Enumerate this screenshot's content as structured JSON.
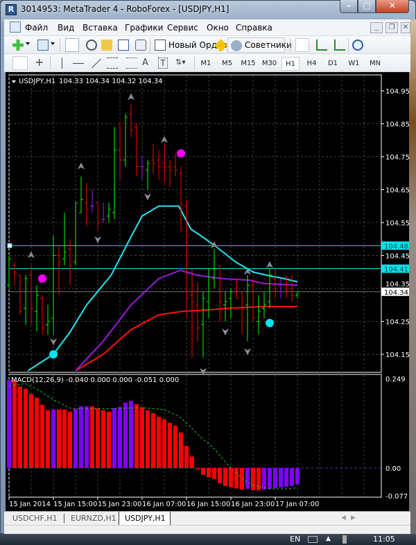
{
  "window": {
    "title": "3014953: MetaTrader 4 - RoboForex - [USDJPY,H1]",
    "app_icon": "R",
    "min": "–",
    "max": "□",
    "close": "✕"
  },
  "menu": [
    "Файл",
    "Вид",
    "Вставка",
    "Графики",
    "Сервис",
    "Окно",
    "Справка"
  ],
  "mdi": {
    "min": "_",
    "restore": "❐",
    "close": "✕"
  },
  "toolbar": {
    "new_order": "Новый Ордер",
    "experts": "Советники"
  },
  "drawing": {
    "text_tool": "A",
    "label_tool": "T"
  },
  "timeframes": {
    "items": [
      "M1",
      "M5",
      "M15",
      "M30",
      "H1",
      "H4",
      "D1",
      "W1",
      "MN"
    ],
    "active": "H1"
  },
  "chart": {
    "symbol": "USDJPY,H1",
    "ohlc": "104.33 104.34 104.32 104.34",
    "price_ticks": [
      "104.95",
      "104.85",
      "104.75",
      "104.65",
      "104.55",
      "104.45",
      "104.35",
      "104.25",
      "104.15"
    ],
    "price_tick_values": [
      104.95,
      104.85,
      104.75,
      104.65,
      104.55,
      104.45,
      104.35,
      104.25,
      104.15
    ],
    "line_labels": [
      "104.48",
      "104.41",
      "104.34"
    ],
    "macd_label": "MACD(12,26,9) -0.040 0.000 0.000 -0.051 0.000",
    "macd_ticks": [
      "0.249",
      "0.00",
      "-0.077"
    ],
    "time_labels": [
      "15 Jan 2014",
      "15 Jan 15:00",
      "15 Jan 23:00",
      "16 Jan 07:00",
      "16 Jan 15:00",
      "16 Jan 23:00",
      "17 Jan 07:00"
    ],
    "colors": {
      "up": "#00ff00",
      "down": "#ff0000",
      "doji": "#9a1eff",
      "fast_ma": "#22e6f0",
      "mid_ma": "#9a1adf",
      "slow_ma": "#ff1010",
      "hline": "#00e5ee",
      "grid": "#3a3f48",
      "macd_up": "#8000ff",
      "macd_down": "#ff0000",
      "signal": "#22cc22"
    }
  },
  "chart_data": {
    "type": "ohlc",
    "ylim": [
      104.1,
      105.0
    ],
    "bars": [
      [
        104.36,
        104.45,
        104.35,
        104.44
      ],
      [
        104.42,
        104.43,
        104.36,
        104.4
      ],
      [
        104.39,
        104.39,
        104.27,
        104.28
      ],
      [
        104.29,
        104.39,
        104.24,
        104.38
      ],
      [
        104.39,
        104.42,
        104.24,
        104.29
      ],
      [
        104.28,
        104.36,
        104.22,
        104.33
      ],
      [
        104.32,
        104.33,
        104.21,
        104.23
      ],
      [
        104.24,
        104.3,
        104.21,
        104.25
      ],
      [
        104.26,
        104.51,
        104.21,
        104.45
      ],
      [
        104.45,
        104.48,
        104.33,
        104.43
      ],
      [
        104.44,
        104.58,
        104.42,
        104.46
      ],
      [
        104.47,
        104.5,
        104.36,
        104.42
      ],
      [
        104.43,
        104.61,
        104.42,
        104.61
      ],
      [
        104.58,
        104.69,
        104.58,
        104.62
      ],
      [
        104.61,
        104.67,
        104.54,
        104.59
      ],
      [
        104.6,
        104.65,
        104.58,
        104.6
      ],
      [
        104.61,
        104.61,
        104.53,
        104.55
      ],
      [
        104.56,
        104.61,
        104.55,
        104.56
      ],
      [
        104.57,
        104.61,
        104.55,
        104.59
      ],
      [
        104.58,
        104.84,
        104.56,
        104.77
      ],
      [
        104.77,
        104.85,
        104.68,
        104.74
      ],
      [
        104.74,
        104.88,
        104.72,
        104.87
      ],
      [
        104.88,
        104.91,
        104.81,
        104.83
      ],
      [
        104.84,
        104.85,
        104.69,
        104.72
      ],
      [
        104.72,
        104.75,
        104.68,
        104.72
      ],
      [
        104.71,
        104.74,
        104.65,
        104.73
      ],
      [
        104.74,
        104.79,
        104.7,
        104.73
      ],
      [
        104.74,
        104.77,
        104.68,
        104.72
      ],
      [
        104.73,
        104.79,
        104.67,
        104.72
      ],
      [
        104.72,
        104.74,
        104.66,
        104.71
      ],
      [
        104.72,
        104.76,
        104.69,
        104.71
      ],
      [
        104.7,
        104.72,
        104.52,
        104.59
      ],
      [
        104.6,
        104.62,
        104.26,
        104.32
      ],
      [
        104.33,
        104.41,
        104.14,
        104.31
      ],
      [
        104.3,
        104.37,
        104.19,
        104.23
      ],
      [
        104.24,
        104.34,
        104.14,
        104.32
      ],
      [
        104.31,
        104.41,
        104.26,
        104.41
      ],
      [
        104.38,
        104.47,
        104.35,
        104.41
      ],
      [
        104.42,
        104.42,
        104.25,
        104.31
      ],
      [
        104.3,
        104.34,
        104.25,
        104.31
      ],
      [
        104.32,
        104.35,
        104.26,
        104.34
      ],
      [
        104.34,
        104.38,
        104.32,
        104.32
      ],
      [
        104.34,
        104.34,
        104.21,
        104.29
      ],
      [
        104.3,
        104.39,
        104.19,
        104.36
      ],
      [
        104.36,
        104.38,
        104.25,
        104.26
      ],
      [
        104.25,
        104.33,
        104.21,
        104.28
      ],
      [
        104.29,
        104.34,
        104.26,
        104.3
      ],
      [
        104.31,
        104.41,
        104.29,
        104.39
      ],
      [
        104.38,
        104.41,
        104.32,
        104.35
      ],
      [
        104.34,
        104.38,
        104.32,
        104.34
      ],
      [
        104.36,
        104.39,
        104.32,
        104.34
      ],
      [
        104.35,
        104.39,
        104.31,
        104.33
      ],
      [
        104.33,
        104.34,
        104.32,
        104.34
      ]
    ],
    "fast_ma": [
      [
        3.4,
        104.1
      ],
      [
        8,
        104.15
      ],
      [
        10.9,
        104.215
      ],
      [
        14,
        104.3
      ],
      [
        18.4,
        104.39
      ],
      [
        22.1,
        104.51
      ],
      [
        24,
        104.57
      ],
      [
        27,
        104.6
      ],
      [
        30.6,
        104.6
      ],
      [
        32.8,
        104.53
      ],
      [
        34.6,
        104.51
      ],
      [
        37.1,
        104.48
      ],
      [
        40.9,
        104.43
      ],
      [
        44,
        104.4
      ],
      [
        46.5,
        104.39
      ],
      [
        49.6,
        104.38
      ],
      [
        52,
        104.37
      ]
    ],
    "mid_ma": [
      [
        12,
        104.1
      ],
      [
        17,
        104.19
      ],
      [
        22,
        104.3
      ],
      [
        27,
        104.38
      ],
      [
        30.9,
        104.405
      ],
      [
        34,
        104.39
      ],
      [
        38.4,
        104.38
      ],
      [
        43.4,
        104.375
      ],
      [
        45.9,
        104.365
      ],
      [
        52,
        104.36
      ]
    ],
    "slow_ma": [
      [
        12,
        104.1
      ],
      [
        17,
        104.15
      ],
      [
        22,
        104.225
      ],
      [
        27,
        104.27
      ],
      [
        31,
        104.28
      ],
      [
        36,
        104.285
      ],
      [
        39.6,
        104.29
      ],
      [
        45.9,
        104.295
      ],
      [
        52,
        104.295
      ]
    ],
    "hlines": [
      104.48,
      104.41,
      104.34
    ],
    "dots": [
      {
        "bar": 6,
        "price": 104.38,
        "color": "#ff00ff"
      },
      {
        "bar": 31,
        "price": 104.76,
        "color": "#ff00ff"
      },
      {
        "bar": 8,
        "price": 104.15,
        "color": "#00e5ee"
      },
      {
        "bar": 47,
        "price": 104.245,
        "color": "#00e5ee"
      }
    ],
    "fractals_up": [
      [
        4,
        104.45
      ],
      [
        13,
        104.72
      ],
      [
        22,
        104.93
      ],
      [
        28,
        104.8
      ],
      [
        37,
        104.48
      ],
      [
        43,
        104.4
      ],
      [
        47,
        104.42
      ]
    ],
    "fractals_down": [
      [
        8,
        104.19
      ],
      [
        16,
        104.5
      ],
      [
        25,
        104.63
      ],
      [
        35,
        104.1
      ],
      [
        39,
        104.22
      ],
      [
        43,
        104.16
      ]
    ],
    "macd_hist": [
      0.245,
      0.245,
      0.227,
      0.221,
      0.206,
      0.196,
      0.176,
      0.161,
      0.163,
      0.163,
      0.163,
      0.157,
      0.165,
      0.172,
      0.172,
      0.172,
      0.167,
      0.161,
      0.157,
      0.167,
      0.17,
      0.182,
      0.187,
      0.178,
      0.169,
      0.161,
      0.153,
      0.143,
      0.136,
      0.126,
      0.118,
      0.099,
      0.062,
      0.032,
      -0.003,
      -0.019,
      -0.026,
      -0.03,
      -0.042,
      -0.05,
      -0.053,
      -0.057,
      -0.06,
      -0.058,
      -0.062,
      -0.062,
      -0.06,
      -0.058,
      -0.056,
      -0.054,
      -0.052,
      -0.05,
      -0.045
    ],
    "macd_up_flags": [
      1,
      0,
      0,
      0,
      0,
      0,
      0,
      0,
      1,
      0,
      0,
      0,
      1,
      1,
      1,
      0,
      0,
      0,
      0,
      1,
      1,
      1,
      1,
      0,
      0,
      0,
      0,
      0,
      0,
      0,
      0,
      0,
      0,
      0,
      0,
      0,
      0,
      0,
      0,
      0,
      0,
      0,
      0,
      1,
      0,
      0,
      1,
      1,
      1,
      1,
      1,
      1,
      1
    ],
    "macd_signal": [
      [
        0,
        0.229
      ],
      [
        3,
        0.235
      ],
      [
        5,
        0.22
      ],
      [
        8,
        0.19
      ],
      [
        11,
        0.167
      ],
      [
        14,
        0.165
      ],
      [
        18,
        0.165
      ],
      [
        24,
        0.168
      ],
      [
        28,
        0.163
      ],
      [
        31,
        0.14
      ],
      [
        33,
        0.11
      ],
      [
        35,
        0.08
      ],
      [
        36.7,
        0.059
      ],
      [
        39.7,
        0.004
      ],
      [
        42,
        -0.028
      ],
      [
        44,
        -0.048
      ],
      [
        47,
        -0.058
      ],
      [
        50,
        -0.058
      ],
      [
        52,
        -0.055
      ]
    ],
    "macd_ylim": [
      -0.077,
      0.249
    ]
  },
  "tabs": [
    "USDCHF,H1",
    "EURNZD,H1",
    "USDJPY,H1"
  ],
  "active_tab": "USDJPY,H1",
  "taskbar": {
    "lang": "EN",
    "time": "11:05"
  }
}
